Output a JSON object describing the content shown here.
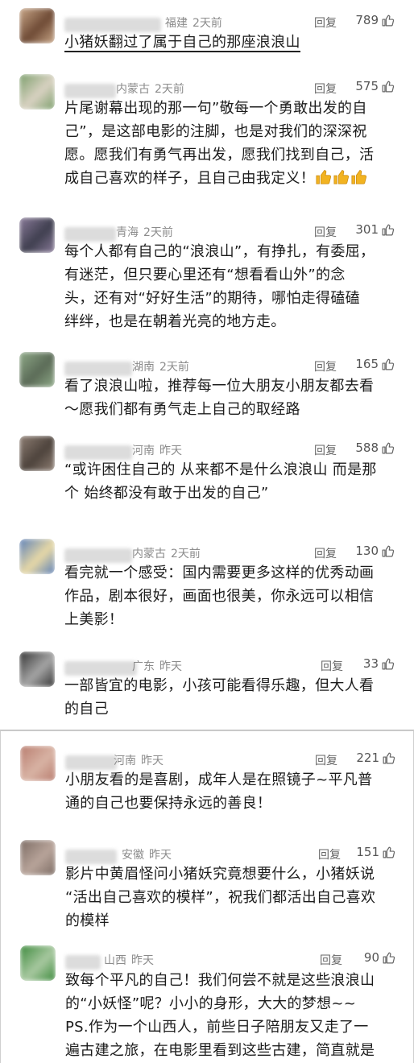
{
  "reply_label": "回复",
  "thumbs_color": "#f2b321",
  "panel1": [
    {
      "location": "福建",
      "time": "2天前",
      "likes": "789",
      "lines": [
        "小猪妖翻过了属于自己的那座浪浪山"
      ]
    },
    {
      "location": "内蒙古",
      "time": "2天前",
      "likes": "575",
      "lines": [
        "片尾谢幕出现的那一句”敬每一个勇敢出发的自",
        "己”，是这部电影的注脚，也是对我们的深深祝",
        "愿。愿我们有勇气再出发，愿我们找到自己，活",
        "成自己喜欢的样子，且自己由我定义！"
      ],
      "emoji": [
        "thumbs-up-emoji",
        "thumbs-up-emoji",
        "thumbs-up-emoji"
      ]
    },
    {
      "location": "青海",
      "time": "2天前",
      "likes": "301",
      "lines": [
        "每个人都有自己的“浪浪山”，有挣扎，有委屈，",
        "有迷茫，但只要心里还有“想看看山外”的念",
        "头，还有对“好好生活”的期待，哪怕走得磕磕",
        "绊绊，也是在朝着光亮的地方走。"
      ]
    },
    {
      "location": "湖南",
      "time": "2天前",
      "likes": "165",
      "lines": [
        "看了浪浪山啦，推荐每一位大朋友小朋友都去看",
        "～愿我们都有勇气走上自己的取经路"
      ]
    },
    {
      "location": "河南",
      "time": "昨天",
      "likes": "588",
      "lines": [
        "“或许困住自己的 从来都不是什么浪浪山 而是那",
        "个 始终都没有敢于出发的自己”"
      ]
    },
    {
      "location": "内蒙古",
      "time": "2天前",
      "likes": "130",
      "lines": [
        "看完就一个感受：国内需要更多这样的优秀动画",
        "作品，剧本很好，画面也很美，你永远可以相信",
        "上美影！"
      ]
    },
    {
      "location": "广东",
      "time": "昨天",
      "likes": "33",
      "lines": [
        "一部皆宜的电影，小孩可能看得乐趣，但大人看",
        "的自己"
      ]
    }
  ],
  "panel2": [
    {
      "location": "河南",
      "time": "昨天",
      "likes": "221",
      "lines": [
        "小朋友看的是喜剧，成年人是在照镜子~平凡普",
        "通的自己也要保持永远的善良！"
      ]
    },
    {
      "location": "安徽",
      "time": "昨天",
      "likes": "151",
      "lines": [
        "影片中黄眉怪问小猪妖究竟想要什么，小猪妖说",
        "“活出自己喜欢的模样”，祝我们都活出自己喜欢",
        "的模样"
      ]
    },
    {
      "location": "山西",
      "time": "昨天",
      "likes": "90",
      "lines": [
        "致每个平凡的自己！我们何尝不就是这些浪浪山",
        "的“小妖怪”呢？小小的身形，大大的梦想~~",
        "PS.作为一个山西人，前些日子陪朋友又走了一",
        "遍古建之旅，在电影里看到这些古建，简直就是"
      ]
    }
  ]
}
